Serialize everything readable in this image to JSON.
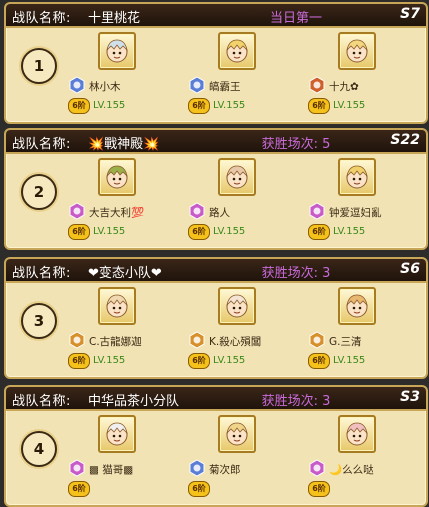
{
  "team_label": "战队名称:",
  "colors": {
    "header_bg": "#2a1a0e",
    "card_bg": "#f2e3b4",
    "stat_purple": "#c86bd8",
    "level_green": "#3a8a1a",
    "border_gold": "#c8a658"
  },
  "teams": [
    {
      "rank": "1",
      "name": "十里桃花",
      "stat": "当日第一",
      "server": "S7",
      "members": [
        {
          "name": "林小木",
          "vip": "6阶",
          "level": "LV.155",
          "badge_color": "#5a7dd6",
          "avatar_hair": "#cfe0ea"
        },
        {
          "name": "皜霸王",
          "vip": "6阶",
          "level": "LV.155",
          "badge_color": "#5a7dd6",
          "avatar_hair": "#f0d36a"
        },
        {
          "name": "十九✿",
          "vip": "6阶",
          "level": "LV.155",
          "badge_color": "#d0602a",
          "avatar_hair": "#f3d680"
        }
      ]
    },
    {
      "rank": "2",
      "name": "💥戰神殿💥",
      "stat": "获胜场次: 5",
      "server": "S22",
      "members": [
        {
          "name": "大吉大利💯",
          "vip": "6阶",
          "level": "LV.155",
          "badge_color": "#c85bc8",
          "avatar_hair": "#9ab04a"
        },
        {
          "name": "路人",
          "vip": "6阶",
          "level": "LV.155",
          "badge_color": "#c85bc8",
          "avatar_hair": "#e8c8a8"
        },
        {
          "name": "钟爱逗妇亂",
          "vip": "6阶",
          "level": "LV.155",
          "badge_color": "#c85bc8",
          "avatar_hair": "#f0d06a"
        }
      ]
    },
    {
      "rank": "3",
      "name": "❤变态小队❤",
      "stat": "获胜场次: 3",
      "server": "S6",
      "members": [
        {
          "name": "C.古龍娜迦",
          "vip": "6阶",
          "level": "LV.155",
          "badge_color": "#d8902a",
          "avatar_hair": "#f0d8b0"
        },
        {
          "name": "K.殺心殞閶",
          "vip": "6阶",
          "level": "LV.155",
          "badge_color": "#d8902a",
          "avatar_hair": "#f4e4d4"
        },
        {
          "name": "G.三清",
          "vip": "6阶",
          "level": "LV.155",
          "badge_color": "#d8902a",
          "avatar_hair": "#e8b870"
        }
      ]
    },
    {
      "rank": "4",
      "name": "中华品茶小分队",
      "stat": "获胜场次: 3",
      "server": "S3",
      "members": [
        {
          "name": "▩ 猫哥▩",
          "vip": "6阶",
          "level": "",
          "badge_color": "#c85bc8",
          "avatar_hair": "#f0f0f0"
        },
        {
          "name": "菊次郎",
          "vip": "6阶",
          "level": "",
          "badge_color": "#5a7dd6",
          "avatar_hair": "#f0d48a"
        },
        {
          "name": "🌙么么哒",
          "vip": "6阶",
          "level": "",
          "badge_color": "#c85bc8",
          "avatar_hair": "#f0c0c0"
        }
      ]
    }
  ]
}
